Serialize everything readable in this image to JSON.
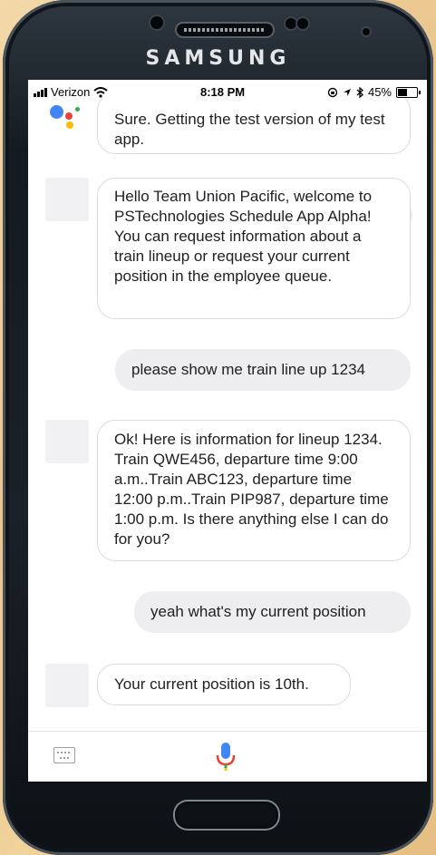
{
  "device": {
    "brand": "SAMSUNG"
  },
  "status_bar": {
    "carrier": "Verizon",
    "time": "8:18 PM",
    "battery": "45%"
  },
  "colors": {
    "accent": "#4285f4",
    "bubble_border": "#dadce0",
    "user_bubble": "#eeeef0"
  },
  "messages": [
    {
      "from": "assistant",
      "text": "Sure. Getting the test version of my test app."
    },
    {
      "from": "assistant",
      "text": "Hello Team Union Pacific, welcome to PSTechnologies Schedule App Alpha! You can request information about a train lineup or request your current position in the employee queue."
    },
    {
      "from": "user",
      "text": "please show me train line up 1234"
    },
    {
      "from": "assistant",
      "text": "Ok! Here is information for lineup 1234. Train QWE456, departure time 9:00 a.m..Train ABC123, departure time 12:00 p.m..Train PIP987, departure time 1:00 p.m. Is there anything else I can do for you?"
    },
    {
      "from": "user",
      "text": "yeah what's my current position"
    },
    {
      "from": "assistant",
      "text": "Your current position is 10th."
    }
  ],
  "icons": {
    "keyboard_toggle": "keyboard-icon",
    "mic": "microphone-icon",
    "assistant": "google-assistant-icon"
  }
}
